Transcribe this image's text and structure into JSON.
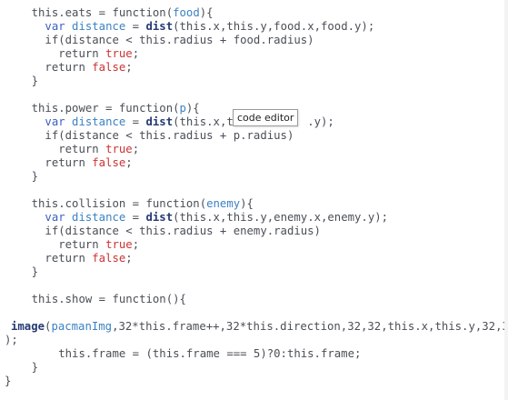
{
  "tooltip": "code editor",
  "code": {
    "eats": {
      "head_a": "this.eats = function(",
      "head_param": "food",
      "head_b": "){",
      "l1_var": "var",
      "l1_name": "distance",
      "l1_eq": " = ",
      "l1_fn": "dist",
      "l1_args": "(this.x,this.y,food.x,food.y);",
      "l2": "if(distance < this.radius + food.radius)",
      "l3_kw": "return",
      "l3_val": "true",
      "l3_end": ";",
      "l4_kw": "return",
      "l4_val": "false",
      "l4_end": ";",
      "close": "}"
    },
    "power": {
      "head_a": "this.power = function(",
      "head_param": "p",
      "head_b": "){",
      "l1_var": "var",
      "l1_name": "distance",
      "l1_eq": " = ",
      "l1_fn": "dist",
      "l1_args_a": "(this.x,th",
      "l1_args_b": ".y);",
      "l2": "if(distance < this.radius + p.radius)",
      "l3_kw": "return",
      "l3_val": "true",
      "l3_end": ";",
      "l4_kw": "return",
      "l4_val": "false",
      "l4_end": ";",
      "close": "}"
    },
    "collision": {
      "head_a": "this.collision = function(",
      "head_param": "enemy",
      "head_b": "){",
      "l1_var": "var",
      "l1_name": "distance",
      "l1_eq": " = ",
      "l1_fn": "dist",
      "l1_args": "(this.x,this.y,enemy.x,enemy.y);",
      "l2": "if(distance < this.radius + enemy.radius)",
      "l3_kw": "return",
      "l3_val": "true",
      "l3_end": ";",
      "l4_kw": "return",
      "l4_val": "false",
      "l4_end": ";",
      "close": "}"
    },
    "show": {
      "head": "this.show = function(){",
      "image_fn": "image",
      "image_open": "(",
      "image_img": "pacmanImg",
      "image_rest": ",32*this.frame++,32*this.direction,32,32,this.x,this.y,32,32",
      "image_end": ");",
      "frame": "this.frame = (this.frame === 5)?0:this.frame;",
      "close": "}"
    },
    "outer_close": "}"
  }
}
